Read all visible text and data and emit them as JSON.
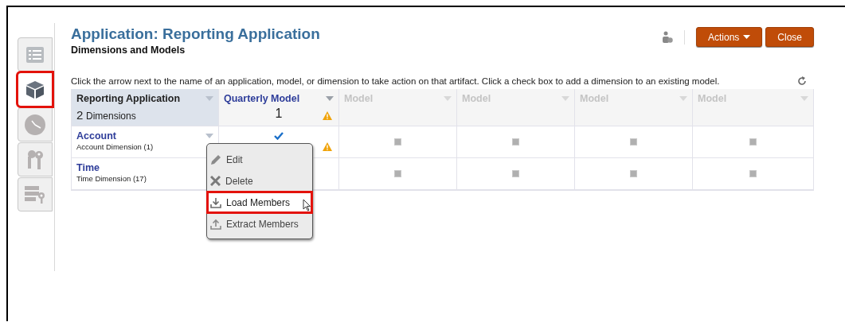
{
  "side_tabs": [
    {
      "kind": "list",
      "selected": false,
      "highlighted": false
    },
    {
      "kind": "cube",
      "selected": true,
      "highlighted": true
    },
    {
      "kind": "clock",
      "selected": false,
      "highlighted": false
    },
    {
      "kind": "keys",
      "selected": false,
      "highlighted": false
    },
    {
      "kind": "server",
      "selected": false,
      "highlighted": false
    }
  ],
  "header": {
    "title": "Application: Reporting Application",
    "subtitle": "Dimensions and Models",
    "buttons": [
      {
        "label": "Actions",
        "dropdown": true
      },
      {
        "label": "Close",
        "dropdown": false
      }
    ]
  },
  "instruction": "Click the arrow next to the name of an application, model, or dimension to take action on that artifact. Click a check box to add a dimension to an existing model.",
  "table": {
    "corner": {
      "name": "Reporting Application",
      "count": "2",
      "count_label": "Dimensions"
    },
    "columns": [
      {
        "title": "Quarterly Model",
        "enabled": true,
        "count": "1",
        "warning": true
      },
      {
        "title": "Model",
        "enabled": false
      },
      {
        "title": "Model",
        "enabled": false
      },
      {
        "title": "Model",
        "enabled": false
      },
      {
        "title": "Model",
        "enabled": false
      }
    ],
    "rows": [
      {
        "name": "Account",
        "description": "Account Dimension  (1)",
        "cells": [
          {
            "kind": "check",
            "checked": true,
            "warning": true
          },
          {
            "kind": "check",
            "checked": false
          },
          {
            "kind": "check",
            "checked": false
          },
          {
            "kind": "check",
            "checked": false
          },
          {
            "kind": "check",
            "checked": false
          }
        ]
      },
      {
        "name": "Time",
        "description": "Time Dimension  (17)",
        "cells": [
          {
            "kind": "covered"
          },
          {
            "kind": "check",
            "checked": false
          },
          {
            "kind": "check",
            "checked": false
          },
          {
            "kind": "check",
            "checked": false
          },
          {
            "kind": "check",
            "checked": false
          }
        ]
      }
    ]
  },
  "context_menu": {
    "items": [
      {
        "label": "Edit",
        "kind": "edit",
        "highlighted": false,
        "hovered": false
      },
      {
        "label": "Delete",
        "kind": "delete",
        "highlighted": false,
        "hovered": false
      },
      {
        "label": "Load Members",
        "kind": "load",
        "highlighted": true,
        "hovered": true
      },
      {
        "label": "Extract Members",
        "kind": "extract",
        "highlighted": false,
        "hovered": false
      }
    ]
  }
}
